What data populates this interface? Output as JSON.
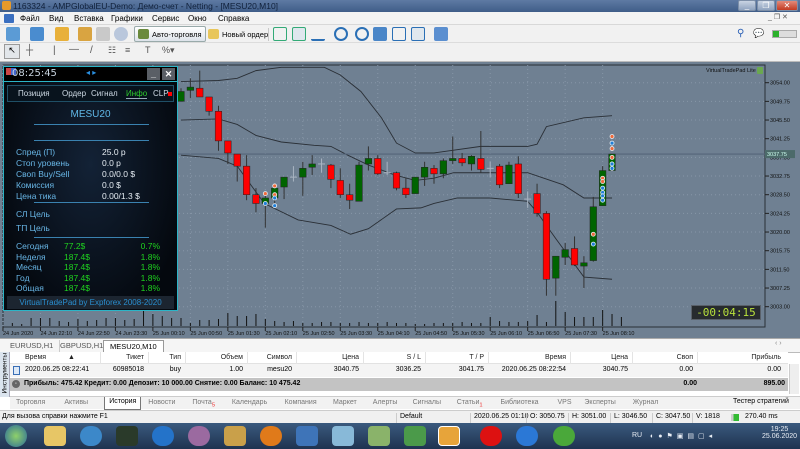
{
  "window": {
    "title": "1163324 - AMPGlobalEU-Demo: Демо-счет - Netting - [MESU20,M10]"
  },
  "menu": [
    "Файл",
    "Вид",
    "Вставка",
    "Графики",
    "Сервис",
    "Окно",
    "Справка"
  ],
  "toolbar": {
    "auto_trading": "Авто-торговля",
    "new_order": "Новый ордер"
  },
  "panel": {
    "clock": "08:25:45",
    "tabs": [
      "Позиция",
      "Ордер",
      "Сигнал",
      "Инфо",
      "CLP"
    ],
    "active_tab": "Инфо",
    "symbol": "MESU20",
    "info": [
      {
        "label": "Спред (П)",
        "value": "25.0 p"
      },
      {
        "label": "Стоп уровень",
        "value": "0.0 p"
      },
      {
        "label": "Своп Buy/Sell",
        "value": "0.0/0.0 $"
      },
      {
        "label": "Комиссия",
        "value": "0.0 $"
      },
      {
        "label": "Цена тика",
        "value": "0.00/1.3 $"
      }
    ],
    "sl_target": "СЛ Цель",
    "tp_target": "ТП Цель",
    "stats": [
      {
        "label": "Сегодня",
        "amount": "77.2$",
        "pct": "0.7%"
      },
      {
        "label": "Неделя",
        "amount": "187.4$",
        "pct": "1.8%"
      },
      {
        "label": "Месяц",
        "amount": "187.4$",
        "pct": "1.8%"
      },
      {
        "label": "Год",
        "amount": "187.4$",
        "pct": "1.8%"
      },
      {
        "label": "Общая",
        "amount": "187.4$",
        "pct": "1.8%"
      }
    ],
    "footer": "VirtualTradePad by Expforex 2008-2020"
  },
  "chart": {
    "indicator_label": "VirtualTradePad Lite",
    "timer": "-00:04:15",
    "current_price_label": "3037.75",
    "colors": {
      "bg": "#6f8092",
      "bull": "#006400",
      "bear": "#ff0000",
      "band": "#2a2f36"
    }
  },
  "chart_data": {
    "type": "candlestick",
    "symbol": "MESU20",
    "timeframe": "M10",
    "ylim": [
      3003.0,
      3054.0
    ],
    "price_ticks": [
      "3054.00",
      "3049.75",
      "3045.50",
      "3041.25",
      "3037.00",
      "3032.75",
      "3028.50",
      "3024.25",
      "3020.00",
      "3015.75",
      "3011.50",
      "3007.25",
      "3003.00"
    ],
    "time_ticks": [
      {
        "i": -19,
        "label": "24 Jun 2020"
      },
      {
        "i": -15,
        "label": "24 Jun 22:10"
      },
      {
        "i": -11,
        "label": "24 Jun 22:50"
      },
      {
        "i": -7,
        "label": "24 Jun 23:30"
      },
      {
        "i": -3,
        "label": "25 Jun 00:10"
      },
      {
        "i": 1,
        "label": "25 Jun 00:50"
      },
      {
        "i": 5,
        "label": "25 Jun 01:30"
      },
      {
        "i": 9,
        "label": "25 Jun 02:10"
      },
      {
        "i": 13,
        "label": "25 Jun 02:50"
      },
      {
        "i": 17,
        "label": "25 Jun 03:30"
      },
      {
        "i": 21,
        "label": "25 Jun 04:10"
      },
      {
        "i": 25,
        "label": "25 Jun 04:50"
      },
      {
        "i": 29,
        "label": "25 Jun 05:30"
      },
      {
        "i": 33,
        "label": "25 Jun 06:10"
      },
      {
        "i": 37,
        "label": "25 Jun 06:50"
      },
      {
        "i": 41,
        "label": "25 Jun 07:30"
      },
      {
        "i": 45,
        "label": "25 Jun 08:10"
      }
    ],
    "ohlc": [
      [
        3049.75,
        3052.75,
        3049.75,
        3052.0
      ],
      [
        3052.25,
        3055.0,
        3050.5,
        3053.0
      ],
      [
        3052.75,
        3056.75,
        3050.75,
        3050.75
      ],
      [
        3050.75,
        3050.75,
        3046.5,
        3047.5
      ],
      [
        3047.5,
        3048.75,
        3038.5,
        3040.75
      ],
      [
        3040.75,
        3040.75,
        3035.5,
        3038.0
      ],
      [
        3037.75,
        3037.75,
        3031.5,
        3035.0
      ],
      [
        3035.0,
        3037.5,
        3027.25,
        3028.5
      ],
      [
        3028.5,
        3030.0,
        3024.5,
        3026.5
      ],
      [
        3026.5,
        3028.75,
        3021.0,
        3027.75
      ],
      [
        3027.75,
        3030.75,
        3026.0,
        3030.0
      ],
      [
        3030.25,
        3032.5,
        3027.5,
        3032.5
      ],
      [
        3032.5,
        3035.0,
        3031.5,
        3032.5
      ],
      [
        3032.5,
        3036.0,
        3028.25,
        3034.5
      ],
      [
        3034.75,
        3037.5,
        3033.0,
        3035.5
      ],
      [
        3035.5,
        3036.75,
        3033.5,
        3035.5
      ],
      [
        3035.25,
        3035.5,
        3030.0,
        3032.0
      ],
      [
        3031.75,
        3034.5,
        3027.75,
        3028.5
      ],
      [
        3028.5,
        3031.0,
        3025.25,
        3027.25
      ],
      [
        3027.0,
        3036.0,
        3027.0,
        3035.25
      ],
      [
        3035.5,
        3039.5,
        3034.0,
        3036.75
      ],
      [
        3036.75,
        3037.5,
        3033.0,
        3033.25
      ],
      [
        3033.5,
        3036.0,
        3033.0,
        3033.5
      ],
      [
        3033.5,
        3033.75,
        3029.5,
        3030.0
      ],
      [
        3030.0,
        3032.25,
        3027.75,
        3028.5
      ],
      [
        3028.75,
        3032.5,
        3028.75,
        3032.5
      ],
      [
        3032.5,
        3036.0,
        3030.5,
        3034.75
      ],
      [
        3034.5,
        3035.25,
        3031.0,
        3033.25
      ],
      [
        3033.25,
        3036.75,
        3032.25,
        3036.25
      ],
      [
        3036.25,
        3041.75,
        3035.5,
        3036.75
      ],
      [
        3036.75,
        3038.0,
        3035.0,
        3035.75
      ],
      [
        3035.5,
        3037.5,
        3034.0,
        3037.25
      ],
      [
        3036.75,
        3043.0,
        3033.5,
        3034.25
      ],
      [
        3034.5,
        3036.0,
        3032.5,
        3034.5
      ],
      [
        3035.0,
        3035.5,
        3030.0,
        3030.75
      ],
      [
        3031.0,
        3036.0,
        3031.0,
        3035.25
      ],
      [
        3035.5,
        3037.25,
        3027.75,
        3028.75
      ],
      [
        3027.5,
        3029.25,
        3025.5,
        3027.5
      ],
      [
        3028.75,
        3031.0,
        3023.5,
        3024.25
      ],
      [
        3024.25,
        3024.75,
        3005.5,
        3009.25
      ],
      [
        3009.5,
        3014.5,
        3005.5,
        3014.5
      ],
      [
        3014.25,
        3017.5,
        3012.5,
        3016.0
      ],
      [
        3016.25,
        3019.0,
        3012.25,
        3012.5
      ],
      [
        3012.25,
        3014.5,
        3007.25,
        3013.0
      ],
      [
        3013.5,
        3028.0,
        3013.25,
        3025.75
      ],
      [
        3026.0,
        3035.0,
        3026.0,
        3034.0
      ],
      [
        3034.0,
        3037.75,
        3034.0,
        3037.75
      ]
    ],
    "volume_first_index": -18,
    "volume": [
      390,
      260,
      1040,
      1040,
      1040,
      650,
      520,
      910,
      650,
      780,
      1040,
      1040,
      780,
      910,
      1950,
      1560,
      1300,
      1040,
      1040,
      390,
      780,
      780,
      910,
      1690,
      1300,
      1300,
      1560,
      910,
      650,
      520,
      650,
      390,
      390,
      520,
      520,
      390,
      390,
      520,
      390,
      390,
      520,
      390,
      390,
      260,
      260,
      390,
      390,
      390,
      520,
      390,
      390,
      1170,
      650,
      520,
      520,
      650,
      1430,
      520,
      3250,
      1820,
      1170,
      1170,
      1170,
      2080,
      1560,
      1170
    ],
    "bollinger": {
      "upper": [
        [
          0,
          3054.25
        ],
        [
          4,
          3054.5
        ],
        [
          6,
          3055.0
        ],
        [
          8,
          3056.75
        ],
        [
          10.7,
          3057.5
        ],
        [
          15.3,
          3057.5
        ],
        [
          17,
          3055.75
        ],
        [
          19.2,
          3052.0
        ],
        [
          21.4,
          3046.0
        ],
        [
          23,
          3040.25
        ],
        [
          25,
          3038.0
        ],
        [
          27,
          3038.0
        ],
        [
          32,
          3039.5
        ],
        [
          37,
          3039.5
        ],
        [
          38,
          3040.0
        ],
        [
          39,
          3044.0
        ],
        [
          43,
          3046.0
        ],
        [
          46,
          3046.5
        ]
      ],
      "middle": [
        [
          0,
          3045.5
        ],
        [
          4,
          3045.75
        ],
        [
          6,
          3044.5
        ],
        [
          8,
          3042.0
        ],
        [
          10.7,
          3040.5
        ],
        [
          14.2,
          3039.75
        ],
        [
          16,
          3039.5
        ],
        [
          17.8,
          3037.5
        ],
        [
          20,
          3035.25
        ],
        [
          22.8,
          3033.0
        ],
        [
          25,
          3031.75
        ],
        [
          27,
          3032.25
        ],
        [
          29.1,
          3033.5
        ],
        [
          32,
          3033.5
        ],
        [
          37,
          3033.5
        ],
        [
          40.8,
          3030.75
        ],
        [
          43,
          3027.75
        ],
        [
          46,
          3027.75
        ]
      ],
      "lower": [
        [
          0,
          3037.5
        ],
        [
          4,
          3036.75
        ],
        [
          6,
          3035.0
        ],
        [
          8.9,
          3026.5
        ],
        [
          12.5,
          3022.75
        ],
        [
          16,
          3021.5
        ],
        [
          18.1,
          3019.5
        ],
        [
          20,
          3020.75
        ],
        [
          23,
          3025.25
        ],
        [
          25.6,
          3025.5
        ],
        [
          27,
          3026.5
        ],
        [
          29.5,
          3027.75
        ],
        [
          33,
          3027.75
        ],
        [
          37,
          3027.0
        ],
        [
          38,
          3024.5
        ],
        [
          40,
          3018.5
        ],
        [
          43,
          3009.75
        ],
        [
          46,
          3009.25
        ]
      ]
    },
    "trade_markers": [
      {
        "i": 9,
        "price": 3028.75,
        "side": "sell"
      },
      {
        "i": 9,
        "price": 3026.5,
        "side": "buy"
      },
      {
        "i": 10,
        "price": 3030.5,
        "side": "sell"
      },
      {
        "i": 10,
        "price": 3028.5,
        "side": "sell"
      },
      {
        "i": 10,
        "price": 3027.75,
        "side": "buy"
      },
      {
        "i": 10,
        "price": 3026.0,
        "side": "buy"
      },
      {
        "i": 44,
        "price": 3019.5,
        "side": "sell"
      },
      {
        "i": 44,
        "price": 3017.25,
        "side": "buy"
      },
      {
        "i": 45,
        "price": 3032.25,
        "side": "sell"
      },
      {
        "i": 45,
        "price": 3031.5,
        "side": "sell"
      },
      {
        "i": 45,
        "price": 3030.0,
        "side": "buy"
      },
      {
        "i": 45,
        "price": 3029.0,
        "side": "buy"
      },
      {
        "i": 45,
        "price": 3028.25,
        "side": "buy"
      },
      {
        "i": 45,
        "price": 3027.25,
        "side": "buy"
      },
      {
        "i": 46,
        "price": 3041.75,
        "side": "sell"
      },
      {
        "i": 46,
        "price": 3040.25,
        "side": "buy"
      },
      {
        "i": 46,
        "price": 3039.0,
        "side": "sell"
      },
      {
        "i": 46,
        "price": 3037.0,
        "side": "sell"
      },
      {
        "i": 46,
        "price": 3035.5,
        "side": "buy"
      },
      {
        "i": 46,
        "price": 3034.5,
        "side": "buy"
      }
    ],
    "current_price": 3037.75
  },
  "chart_tabs": [
    "EURUSD,H1",
    "GBPUSD,H1",
    "MESU20,M10"
  ],
  "toolbox": {
    "side_label": "Инструменты",
    "columns": [
      "Время",
      "Тикет",
      "Тип",
      "Объем",
      "Символ",
      "Цена",
      "S / L",
      "T / P",
      "Время",
      "Цена",
      "Своп",
      "Прибыль"
    ],
    "rows": [
      [
        "2020.06.25 08:22:41",
        "60985018",
        "buy",
        "1.00",
        "mesu20",
        "3040.75",
        "3036.25",
        "3041.75",
        "2020.06.25 08:22:54",
        "3040.75",
        "0.00",
        "0.00"
      ]
    ],
    "summary": "Прибыль: 475.42  Кредит: 0.00  Депозит: 10 000.00  Снятие: 0.00  Баланс: 10 475.42",
    "summary_swap": "0.00",
    "summary_profit": "895.00",
    "tabs": [
      {
        "label": "Торговля"
      },
      {
        "label": "Активы"
      },
      {
        "label": "История"
      },
      {
        "label": "Новости"
      },
      {
        "label": "Почта",
        "badge": "5"
      },
      {
        "label": "Календарь"
      },
      {
        "label": "Компания"
      },
      {
        "label": "Маркет"
      },
      {
        "label": "Алерты"
      },
      {
        "label": "Сигналы"
      },
      {
        "label": "Статьи",
        "badge": "1"
      },
      {
        "label": "Библиотека"
      },
      {
        "label": "VPS"
      },
      {
        "label": "Эксперты"
      },
      {
        "label": "Журнал"
      }
    ],
    "active_tab": "История",
    "tester": "Тестер стратегий"
  },
  "status": {
    "help": "Для вызова справки нажмите F1",
    "profile": "Default",
    "time": "2020.06.25 01:10",
    "open": "O: 3050.75",
    "high": "H: 3051.00",
    "low": "L: 3046.50",
    "close": "C: 3047.50",
    "volume": "V: 1818",
    "ping": "270.40 ms"
  },
  "taskbar": {
    "lang": "RU",
    "time": "19:25",
    "date": "25.06.2020"
  }
}
